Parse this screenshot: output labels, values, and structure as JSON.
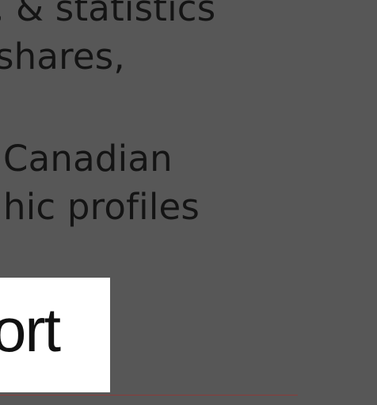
{
  "content": {
    "lines": [
      ", & statistics",
      "shares,",
      "Canadian",
      "hic profiles"
    ],
    "button_label": "ort"
  },
  "colors": {
    "background": "#575757",
    "text": "#141414",
    "button_background": "#ffffff",
    "divider": "#8b3b38"
  }
}
